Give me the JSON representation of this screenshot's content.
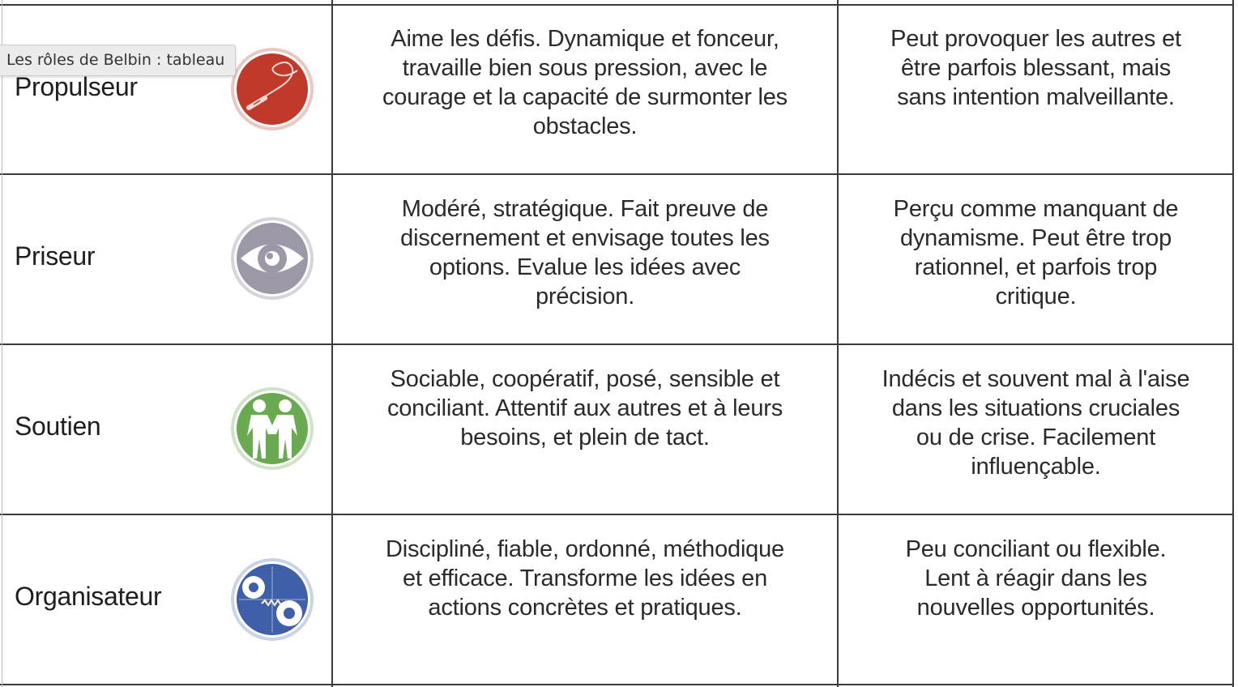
{
  "tooltip": "Les rôles de Belbin : tableau",
  "rows": [
    {
      "role": "Propulseur",
      "icon": "whip-icon",
      "icon_color": "#c0392b",
      "strengths": "Aime les défis. Dynamique et fonceur,\ntravaille bien sous pression, avec le\ncourage et la capacité de surmonter les\nobstacles.",
      "weaknesses": "Peut provoquer les autres et\nêtre parfois blessant, mais\nsans intention malveillante."
    },
    {
      "role": "Priseur",
      "icon": "eye-icon",
      "icon_color": "#9c98a8",
      "strengths": "Modéré, stratégique. Fait preuve de\ndiscernement et envisage toutes les\noptions. Evalue les idées avec\nprécision.",
      "weaknesses": "Perçu comme manquant de\ndynamisme. Peut être trop\nrationnel, et parfois trop\ncritique."
    },
    {
      "role": "Soutien",
      "icon": "two-people-icon",
      "icon_color": "#6aab52",
      "strengths": "Sociable, coopératif, posé, sensible et\nconciliant. Attentif aux autres et à leurs\nbesoins, et plein de tact.",
      "weaknesses": "Indécis et souvent mal à l'aise\ndans les situations cruciales\nou de crise. Facilement\ninfluençable."
    },
    {
      "role": "Organisateur",
      "icon": "gears-icon",
      "icon_color": "#3f5fa8",
      "strengths": "Discipliné, fiable, ordonné, méthodique\net efficace. Transforme les idées en\nactions concrètes et pratiques.",
      "weaknesses": "Peu conciliant ou flexible.\nLent à réagir dans les\nnouvelles opportunités."
    }
  ]
}
